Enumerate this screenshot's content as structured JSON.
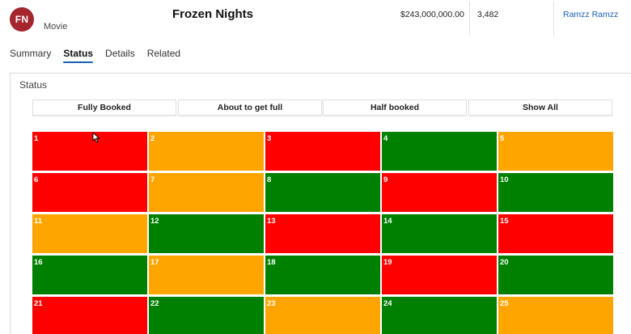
{
  "header": {
    "avatar_initials": "FN",
    "entity_type": "Movie",
    "title": "Frozen Nights",
    "budget": "$243,000,000.00",
    "count": "3,482",
    "owner": "Ramzz Ramzz"
  },
  "tabs": [
    {
      "label": "Summary",
      "active": false
    },
    {
      "label": "Status",
      "active": true
    },
    {
      "label": "Details",
      "active": false
    },
    {
      "label": "Related",
      "active": false
    }
  ],
  "status_section": {
    "title": "Status",
    "filters": [
      {
        "label": "Fully Booked"
      },
      {
        "label": "About to get full"
      },
      {
        "label": "Half booked"
      },
      {
        "label": "Show All"
      }
    ]
  },
  "colors": {
    "red": "#ff0000",
    "orange": "#ffa500",
    "green": "#008000",
    "accent": "#1a5fb4",
    "avatar": "#a4262c"
  },
  "seats": [
    {
      "number": "1",
      "status": "red"
    },
    {
      "number": "2",
      "status": "orange"
    },
    {
      "number": "3",
      "status": "red"
    },
    {
      "number": "4",
      "status": "green"
    },
    {
      "number": "5",
      "status": "orange"
    },
    {
      "number": "6",
      "status": "red"
    },
    {
      "number": "7",
      "status": "orange"
    },
    {
      "number": "8",
      "status": "green"
    },
    {
      "number": "9",
      "status": "red"
    },
    {
      "number": "10",
      "status": "green"
    },
    {
      "number": "11",
      "status": "orange"
    },
    {
      "number": "12",
      "status": "green"
    },
    {
      "number": "13",
      "status": "red"
    },
    {
      "number": "14",
      "status": "green"
    },
    {
      "number": "15",
      "status": "red"
    },
    {
      "number": "16",
      "status": "green"
    },
    {
      "number": "17",
      "status": "orange"
    },
    {
      "number": "18",
      "status": "green"
    },
    {
      "number": "19",
      "status": "red"
    },
    {
      "number": "20",
      "status": "green"
    },
    {
      "number": "21",
      "status": "red"
    },
    {
      "number": "22",
      "status": "green"
    },
    {
      "number": "23",
      "status": "orange"
    },
    {
      "number": "24",
      "status": "green"
    },
    {
      "number": "25",
      "status": "orange"
    }
  ]
}
